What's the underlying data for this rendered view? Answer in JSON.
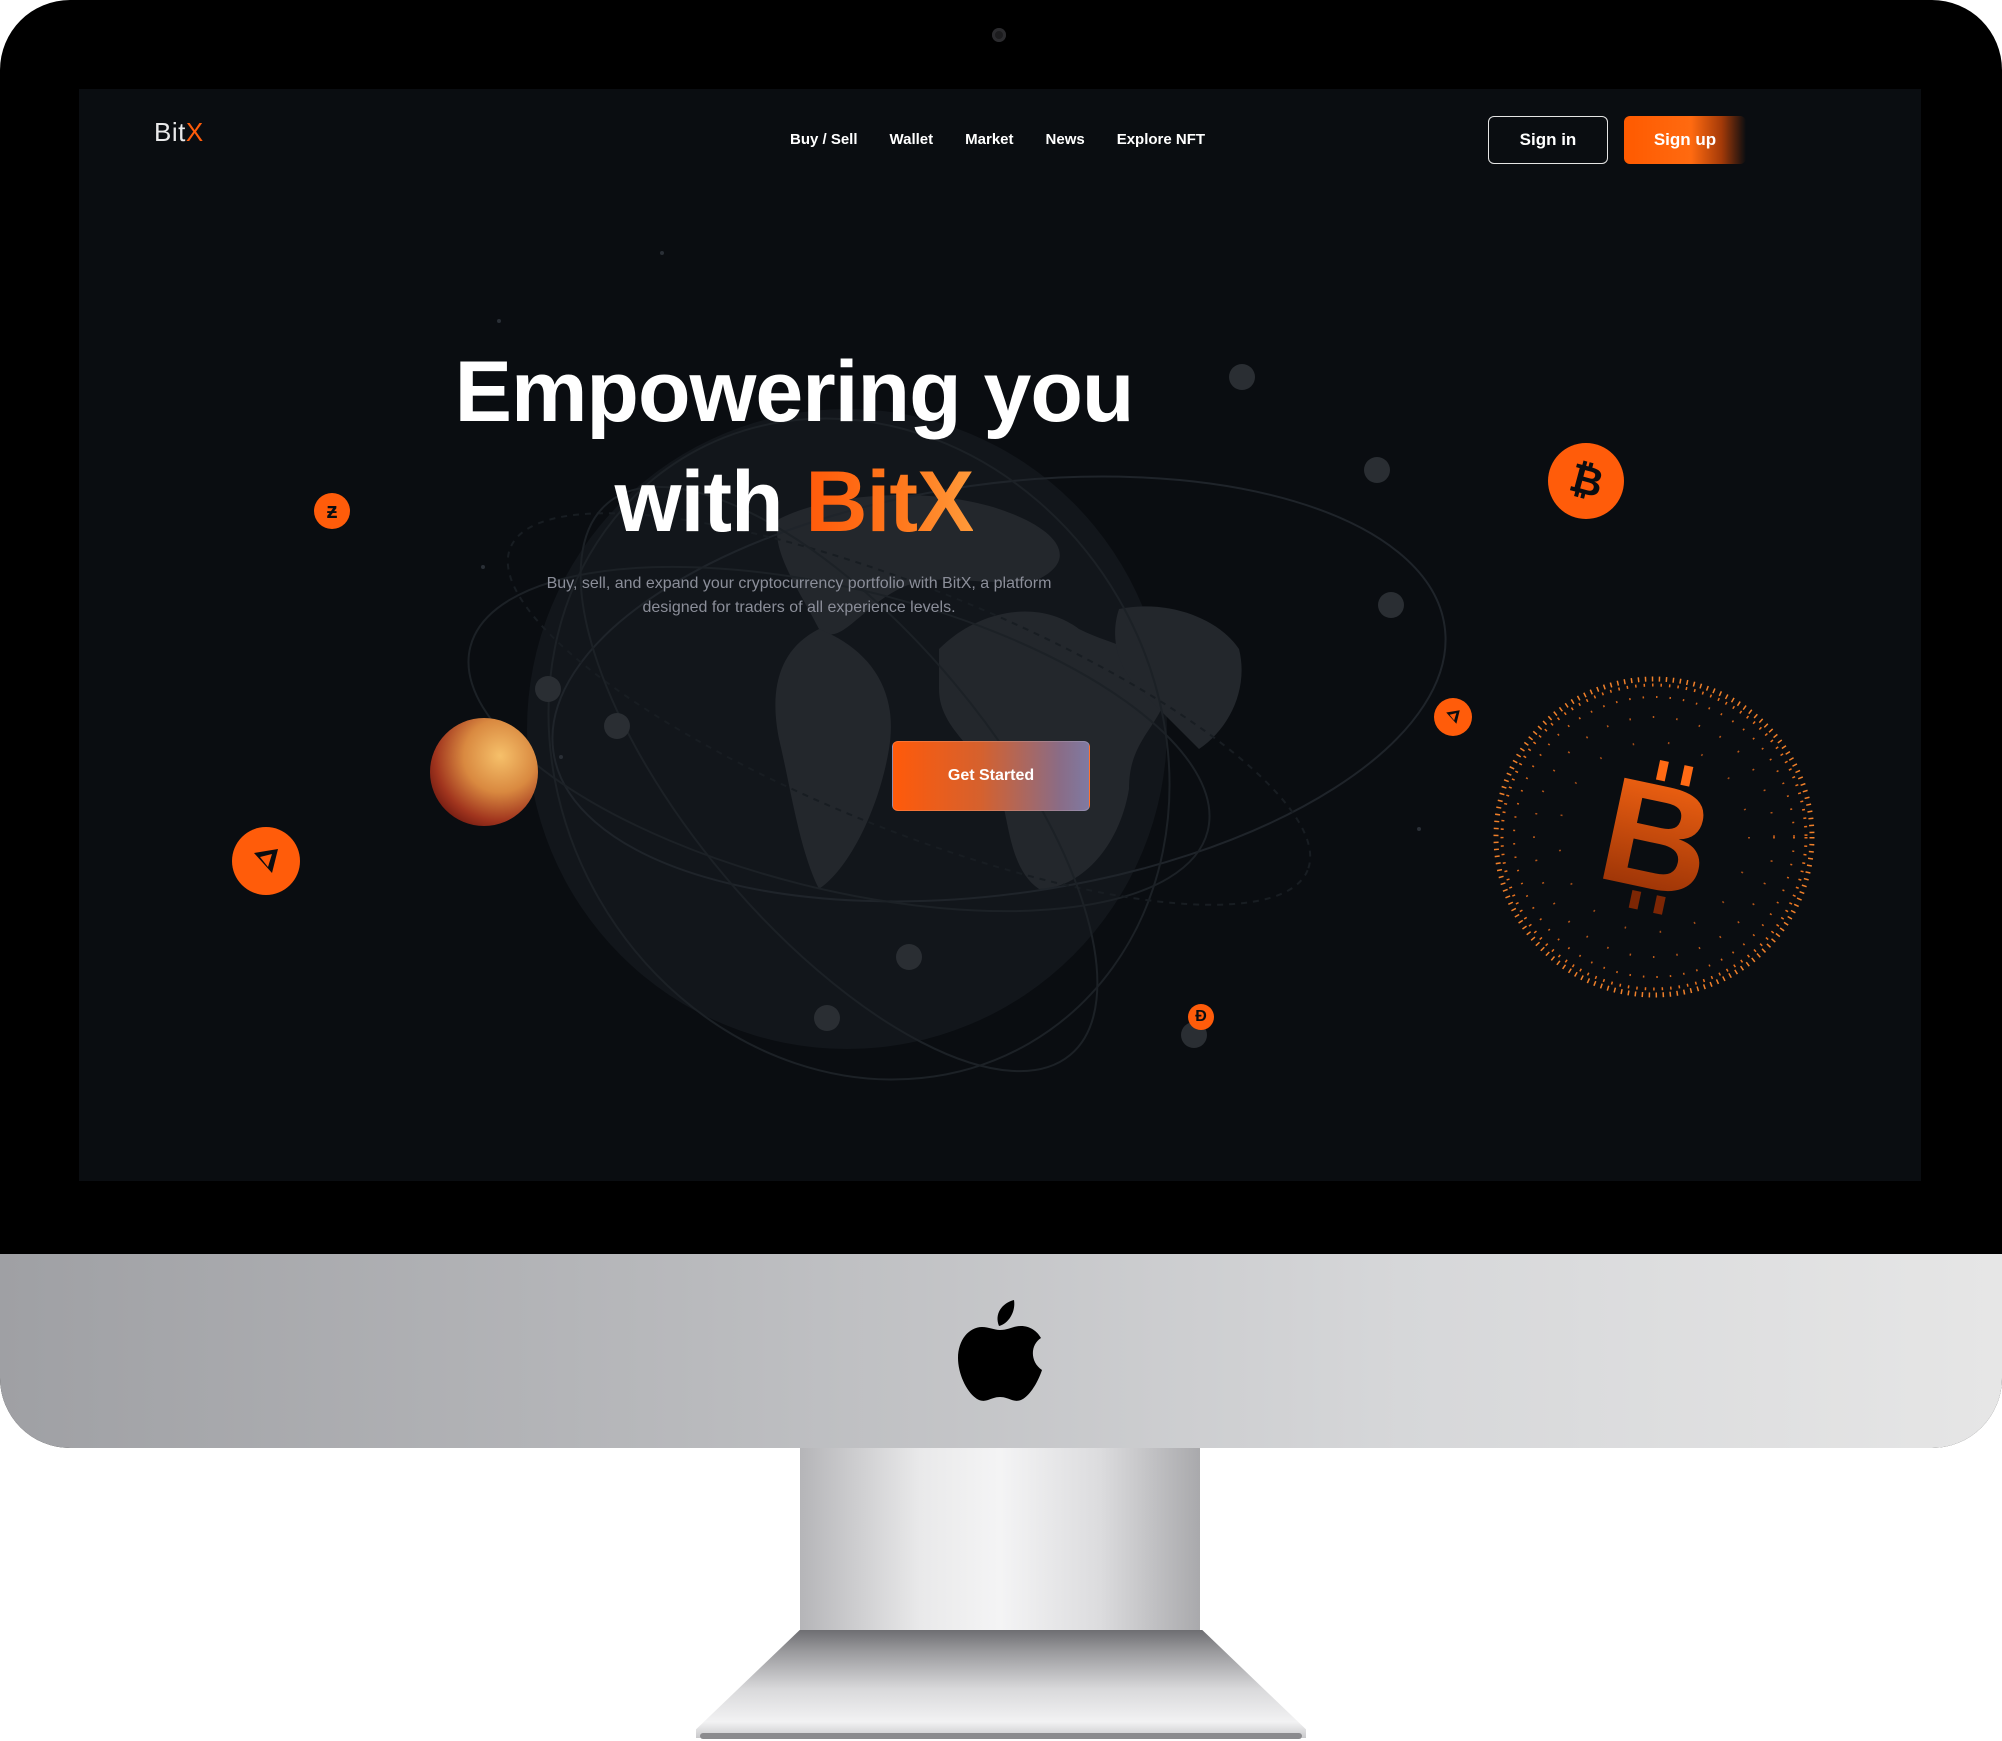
{
  "header": {
    "logo_main": "Bit",
    "logo_accent": "X",
    "nav": [
      {
        "label": "Buy / Sell"
      },
      {
        "label": "Wallet"
      },
      {
        "label": "Market"
      },
      {
        "label": "News"
      },
      {
        "label": "Explore NFT"
      }
    ],
    "sign_in_label": "Sign in",
    "sign_up_label": "Sign up"
  },
  "hero": {
    "title_line1": "Empowering you",
    "title_line2_prefix": "with ",
    "title_brand": "BitX",
    "subtitle_line1": "Buy, sell, and expand your cryptocurrency portfolio with BitX, a platform",
    "subtitle_line2": "designed for traders of all experience levels.",
    "cta_label": "Get Started"
  },
  "icons": {
    "bitcoin": "bitcoin-icon",
    "ethereum": "ethereum-icon",
    "zcash": "zcash-icon",
    "dash": "dash-icon",
    "apple": "apple-logo-icon"
  },
  "colors": {
    "accent": "#ff5c0a",
    "screen_bg": "#0a0d11",
    "subtitle": "#8b8e99"
  }
}
